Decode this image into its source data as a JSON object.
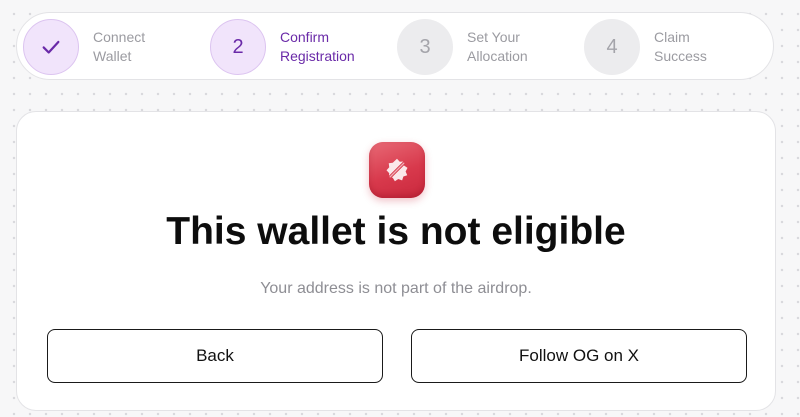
{
  "stepper": {
    "steps": [
      {
        "number": "",
        "line1": "Connect",
        "line2": "Wallet",
        "state": "done",
        "icon": "check-icon"
      },
      {
        "number": "2",
        "line1": "Confirm",
        "line2": "Registration",
        "state": "active"
      },
      {
        "number": "3",
        "line1": "Set Your",
        "line2": "Allocation",
        "state": "pending"
      },
      {
        "number": "4",
        "line1": "Claim",
        "line2": "Success",
        "state": "pending"
      }
    ]
  },
  "result": {
    "icon": "alert-badge-icon",
    "title": "This wallet is not eligible",
    "message": "Your address is not part of the airdrop."
  },
  "actions": {
    "back_label": "Back",
    "follow_label": "Follow OG on X"
  },
  "colors": {
    "accent_purple": "#6a2aa8",
    "step_active_bg": "#f1e4fb",
    "step_pending_bg": "#ececee",
    "error_red": "#d8394c"
  }
}
